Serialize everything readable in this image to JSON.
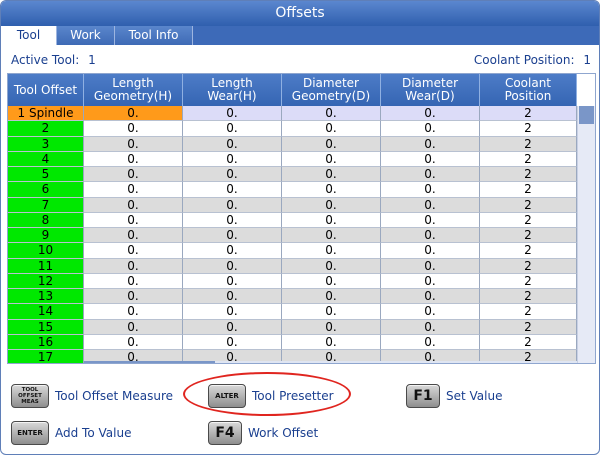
{
  "window": {
    "title": "Offsets"
  },
  "tabs": [
    {
      "label": "Tool",
      "active": true
    },
    {
      "label": "Work",
      "active": false
    },
    {
      "label": "Tool Info",
      "active": false
    }
  ],
  "info": {
    "active_tool_label": "Active Tool:",
    "active_tool_value": "1",
    "coolant_label": "Coolant Position:",
    "coolant_value": "1"
  },
  "table": {
    "headers": [
      "Tool Offset",
      "Length\nGeometry(H)",
      "Length\nWear(H)",
      "Diameter\nGeometry(D)",
      "Diameter\nWear(D)",
      "Coolant\nPosition"
    ],
    "rows": [
      {
        "name": "1 Spindle",
        "values": [
          "0.",
          "0.",
          "0.",
          "0.",
          "2"
        ]
      },
      {
        "name": "2",
        "values": [
          "0.",
          "0.",
          "0.",
          "0.",
          "2"
        ]
      },
      {
        "name": "3",
        "values": [
          "0.",
          "0.",
          "0.",
          "0.",
          "2"
        ]
      },
      {
        "name": "4",
        "values": [
          "0.",
          "0.",
          "0.",
          "0.",
          "2"
        ]
      },
      {
        "name": "5",
        "values": [
          "0.",
          "0.",
          "0.",
          "0.",
          "2"
        ]
      },
      {
        "name": "6",
        "values": [
          "0.",
          "0.",
          "0.",
          "0.",
          "2"
        ]
      },
      {
        "name": "7",
        "values": [
          "0.",
          "0.",
          "0.",
          "0.",
          "2"
        ]
      },
      {
        "name": "8",
        "values": [
          "0.",
          "0.",
          "0.",
          "0.",
          "2"
        ]
      },
      {
        "name": "9",
        "values": [
          "0.",
          "0.",
          "0.",
          "0.",
          "2"
        ]
      },
      {
        "name": "10",
        "values": [
          "0.",
          "0.",
          "0.",
          "0.",
          "2"
        ]
      },
      {
        "name": "11",
        "values": [
          "0.",
          "0.",
          "0.",
          "0.",
          "2"
        ]
      },
      {
        "name": "12",
        "values": [
          "0.",
          "0.",
          "0.",
          "0.",
          "2"
        ]
      },
      {
        "name": "13",
        "values": [
          "0.",
          "0.",
          "0.",
          "0.",
          "2"
        ]
      },
      {
        "name": "14",
        "values": [
          "0.",
          "0.",
          "0.",
          "0.",
          "2"
        ]
      },
      {
        "name": "15",
        "values": [
          "0.",
          "0.",
          "0.",
          "0.",
          "2"
        ]
      },
      {
        "name": "16",
        "values": [
          "0.",
          "0.",
          "0.",
          "0.",
          "2"
        ]
      },
      {
        "name": "17",
        "values": [
          "0.",
          "0.",
          "0.",
          "0.",
          "2"
        ]
      }
    ],
    "selected_row": 0
  },
  "keys": {
    "tool_offset_meas": {
      "key": "TOOL\nOFFSET\nMEAS",
      "label": "Tool Offset Measure"
    },
    "alter": {
      "key": "ALTER",
      "label": "Tool Presetter"
    },
    "f1": {
      "key": "F1",
      "label": "Set Value"
    },
    "enter": {
      "key": "ENTER",
      "label": "Add To Value"
    },
    "f4": {
      "key": "F4",
      "label": "Work Offset"
    }
  },
  "colors": {
    "title_blue": "#2f5fae",
    "tool_cell_green": "#00e800",
    "selected_orange": "#ff9a1a",
    "highlight_red": "#e0251f"
  }
}
